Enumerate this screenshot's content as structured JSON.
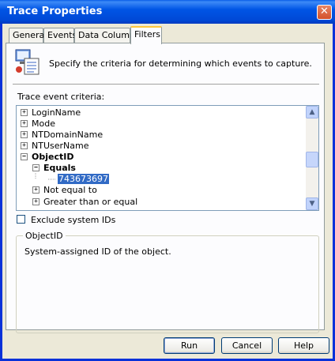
{
  "window": {
    "title": "Trace Properties",
    "close_glyph": "✕"
  },
  "tabs": [
    {
      "label": "General"
    },
    {
      "label": "Events"
    },
    {
      "label": "Data Columns"
    },
    {
      "label": "Filters",
      "active": true
    }
  ],
  "header": {
    "text": "Specify the criteria for determining which events to capture."
  },
  "criteria": {
    "label": "Trace event criteria:",
    "items": [
      {
        "label": "LoginName",
        "expander": "+"
      },
      {
        "label": "Mode",
        "expander": "+"
      },
      {
        "label": "NTDomainName",
        "expander": "+"
      },
      {
        "label": "NTUserName",
        "expander": "+"
      },
      {
        "label": "ObjectID",
        "expander": "−",
        "bold": true
      },
      {
        "label": "Equals",
        "expander": "−",
        "bold": true
      },
      {
        "label": "743673697",
        "selected": true
      },
      {
        "label": "Not equal to",
        "expander": "+"
      },
      {
        "label": "Greater than or equal",
        "expander": "+"
      }
    ]
  },
  "exclude": {
    "label": "Exclude system IDs",
    "checked": false
  },
  "description": {
    "title": "ObjectID",
    "text": "System-assigned ID of the object."
  },
  "buttons": {
    "run": "Run",
    "cancel": "Cancel",
    "help": "Help"
  },
  "icons": {
    "close": "close-icon",
    "header": "filter-properties-icon",
    "scroll_up": "arrow-up-icon",
    "scroll_down": "arrow-down-icon"
  },
  "colors": {
    "titlebar": "#0055e5",
    "selection": "#316ac5",
    "tab_highlight": "#ffc83c"
  }
}
